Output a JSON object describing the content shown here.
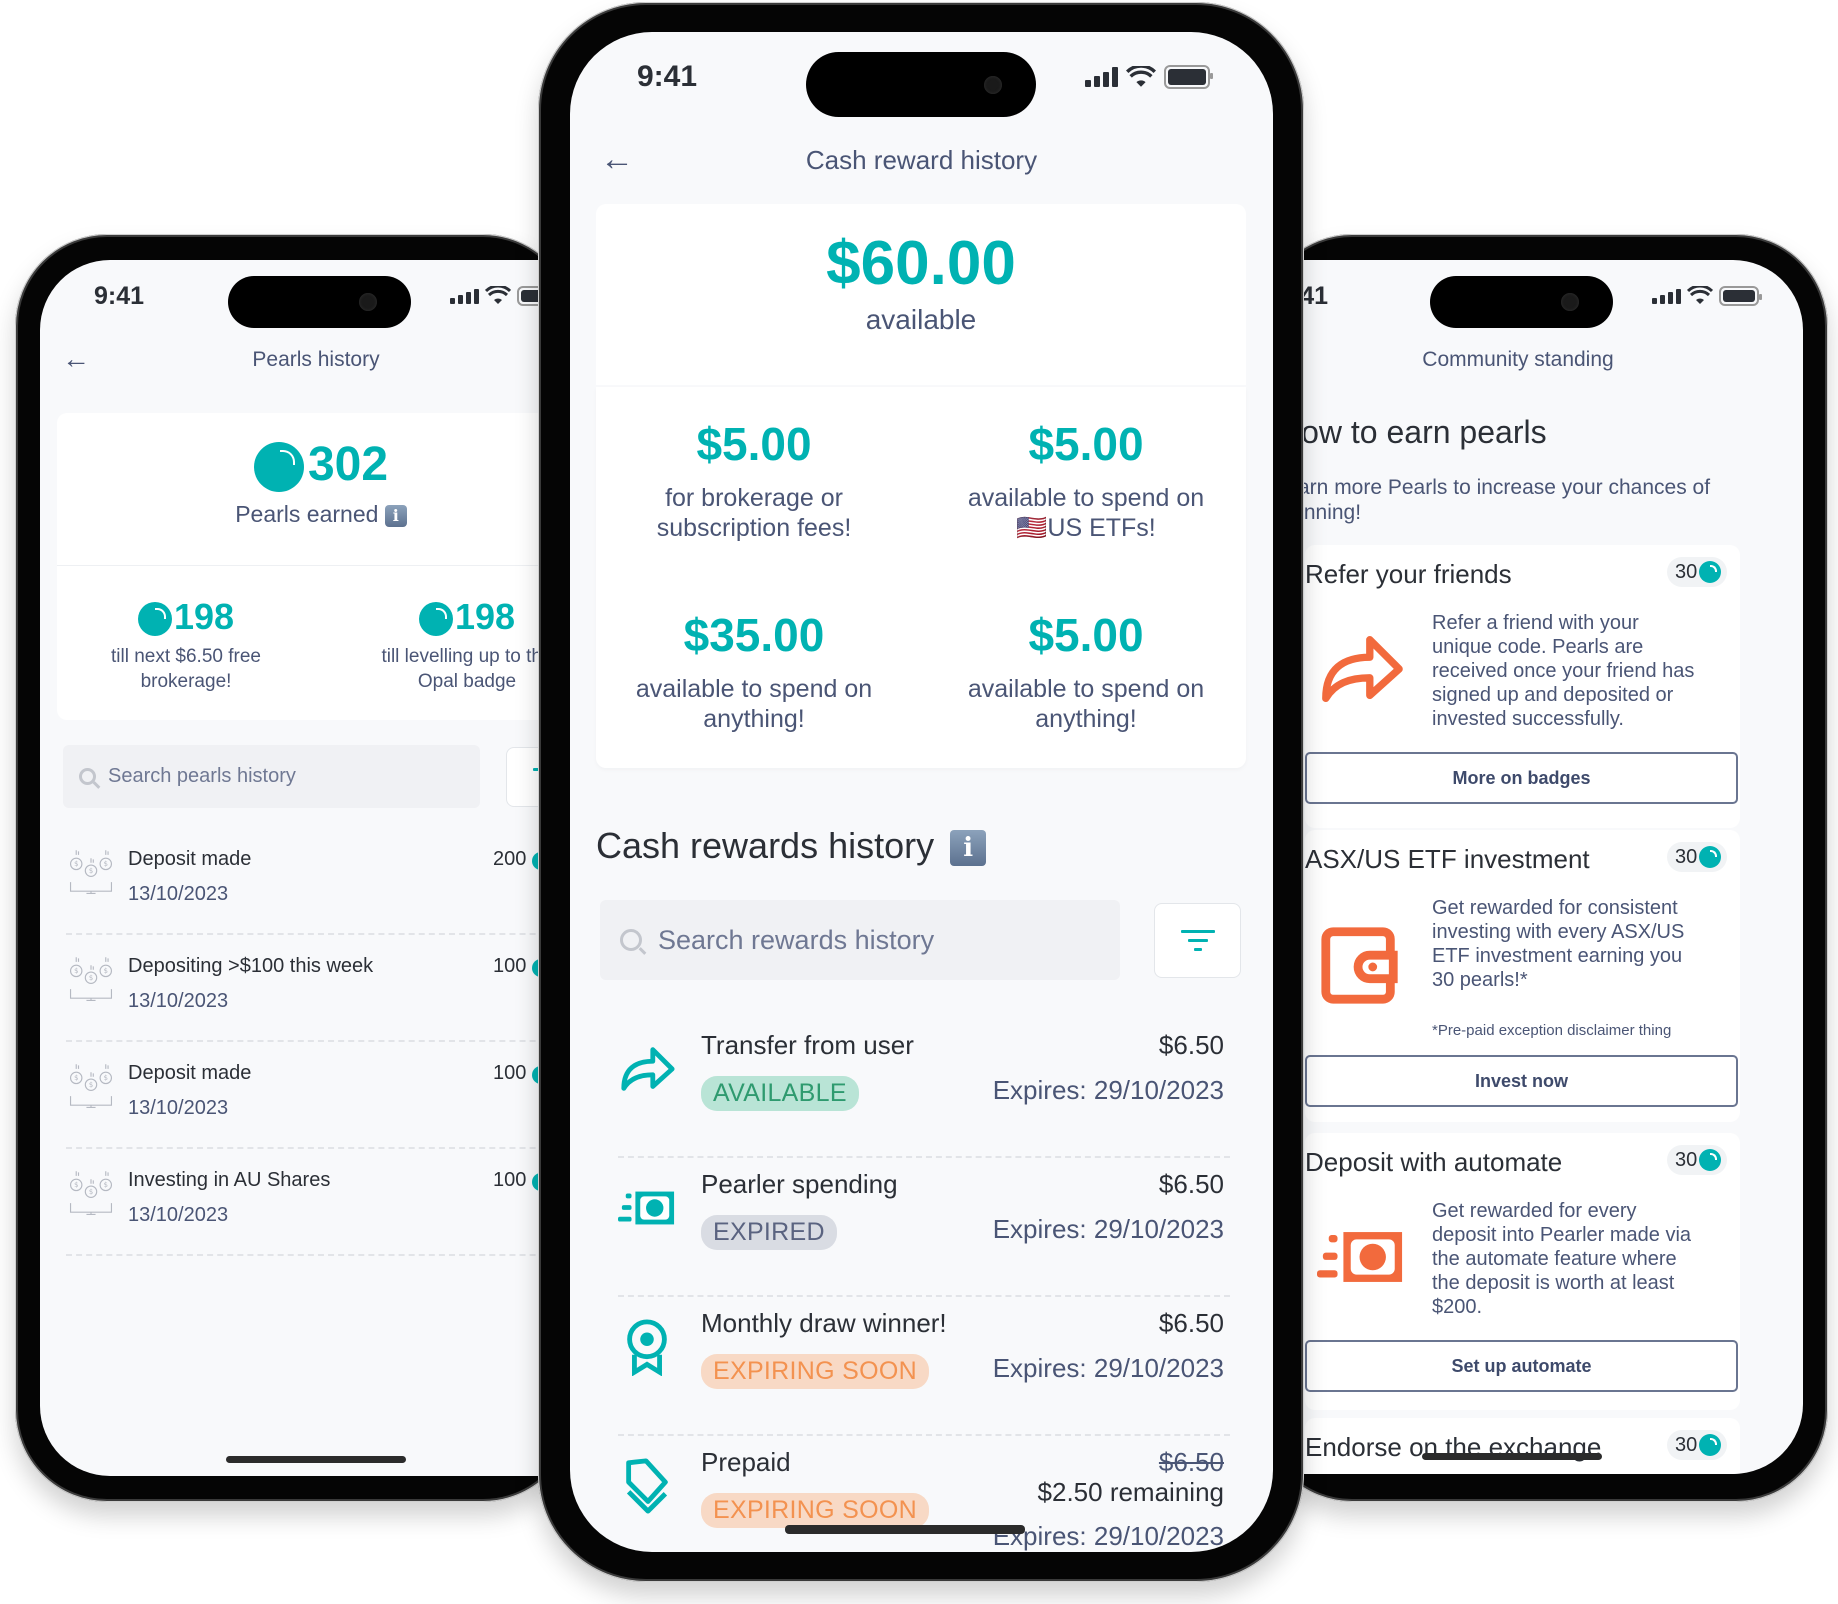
{
  "status_bar": {
    "time": "9:41"
  },
  "colors": {
    "accent_teal": "#00b2b2",
    "accent_orange": "#f26a3d",
    "text_muted": "#4a5575"
  },
  "left_phone": {
    "title": "Pearls history",
    "back_icon": "arrow-left-icon",
    "total": {
      "value": "302",
      "label": "Pearls earned"
    },
    "stats": [
      {
        "value": "198",
        "label_line1": "till next $6.50 free",
        "label_line2": "brokerage!"
      },
      {
        "value": "198",
        "label_line1": "till levelling up to the",
        "label_line2": "Opal badge"
      }
    ],
    "search_placeholder": "Search pearls history",
    "items": [
      {
        "title": "Deposit made",
        "date": "13/10/2023",
        "points": "200"
      },
      {
        "title": "Depositing >$100 this week",
        "date": "13/10/2023",
        "points": "100"
      },
      {
        "title": "Deposit made",
        "date": "13/10/2023",
        "points": "100"
      },
      {
        "title": "Investing in AU Shares",
        "date": "13/10/2023",
        "points": "100"
      }
    ]
  },
  "center_phone": {
    "title": "Cash reward history",
    "back_icon": "arrow-left-icon",
    "total": {
      "amount": "$60.00",
      "label": "available"
    },
    "breakdown": [
      {
        "amount": "$5.00",
        "line1": "for brokerage or",
        "line2": "subscription fees!"
      },
      {
        "amount": "$5.00",
        "line1": "available to spend on",
        "line2": "🇺🇸US ETFs!"
      },
      {
        "amount": "$35.00",
        "line1": "available to spend on",
        "line2": "anything!"
      },
      {
        "amount": "$5.00",
        "line1": "available to spend on",
        "line2": "anything!"
      }
    ],
    "section_title": "Cash rewards history",
    "search_placeholder": "Search rewards history",
    "rewards": [
      {
        "icon": "share-arrow-icon",
        "title": "Transfer from user",
        "status": "AVAILABLE",
        "status_kind": "available",
        "amount": "$6.50",
        "expires": "Expires: 29/10/2023"
      },
      {
        "icon": "cash-note-icon",
        "title": "Pearler spending",
        "status": "EXPIRED",
        "status_kind": "expired",
        "amount": "$6.50",
        "expires": "Expires: 29/10/2023"
      },
      {
        "icon": "award-ribbon-icon",
        "title": "Monthly draw winner!",
        "status": "EXPIRING SOON",
        "status_kind": "soon",
        "amount": "$6.50",
        "expires": "Expires: 29/10/2023"
      },
      {
        "icon": "price-tags-icon",
        "title": "Prepaid",
        "status": "EXPIRING SOON",
        "status_kind": "soon",
        "original_amount": "$6.50",
        "remaining": "$2.50 remaining",
        "expires": "Expires: 29/10/2023"
      }
    ]
  },
  "right_phone": {
    "title": "Community standing",
    "heading": "How to earn pearls",
    "subtitle_line1": "Earn more Pearls to increase your chances of",
    "subtitle_line2": "winning!",
    "cards": [
      {
        "title": "Refer your friends",
        "points": "30",
        "icon": "share-arrow-icon",
        "lines": [
          "Refer a friend with your",
          "unique code. Pearls are",
          "received once your friend has",
          "signed up and deposited or",
          "invested successfully."
        ],
        "button": "More on badges"
      },
      {
        "title": "ASX/US ETF investment",
        "points": "30",
        "icon": "wallet-icon",
        "lines": [
          "Get rewarded for consistent",
          "investing with every ASX/US",
          "ETF investment earning you",
          "30 pearls!*"
        ],
        "disclaimer": "*Pre-paid exception disclaimer thing",
        "button": "Invest now"
      },
      {
        "title": "Deposit with automate",
        "points": "30",
        "icon": "cash-note-icon",
        "lines": [
          "Get rewarded for every",
          "deposit into Pearler made via",
          "the automate feature where",
          "the deposit is worth at least",
          "$200."
        ],
        "button": "Set up automate"
      },
      {
        "title": "Endorse on the exchange",
        "points": "30"
      }
    ]
  }
}
